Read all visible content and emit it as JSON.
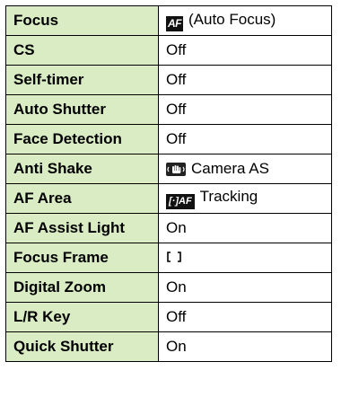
{
  "rows": [
    {
      "label": "Focus",
      "value": "(Auto Focus)",
      "icon": "af-icon",
      "icon_text": "AF"
    },
    {
      "label": "CS",
      "value": "Off"
    },
    {
      "label": "Self-timer",
      "value": "Off"
    },
    {
      "label": "Auto Shutter",
      "value": "Off"
    },
    {
      "label": "Face Detection",
      "value": "Off"
    },
    {
      "label": "Anti Shake",
      "value": "Camera AS",
      "icon": "anti-shake-hand-icon"
    },
    {
      "label": "AF Area",
      "value": "Tracking",
      "icon": "af-tracking-icon",
      "icon_text": "AF"
    },
    {
      "label": "AF Assist Light",
      "value": "On"
    },
    {
      "label": "Focus Frame",
      "value": "",
      "icon": "focus-frame-icon"
    },
    {
      "label": "Digital Zoom",
      "value": "On"
    },
    {
      "label": "L/R Key",
      "value": "Off"
    },
    {
      "label": "Quick Shutter",
      "value": "On"
    }
  ],
  "colors": {
    "label_background": "#d9ecc4",
    "value_background": "#ffffff",
    "border": "#000000"
  }
}
